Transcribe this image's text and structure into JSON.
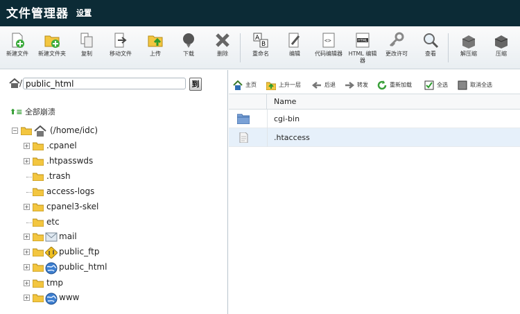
{
  "header": {
    "title": "文件管理器",
    "settings": "设置"
  },
  "toolbar": {
    "new_file": "新建文件",
    "new_folder": "新建文件夹",
    "copy": "复制",
    "move": "移动文件",
    "upload": "上传",
    "download": "下载",
    "delete": "删除",
    "rename": "重命名",
    "edit": "编辑",
    "code_edit": "代码编辑器",
    "html_edit": "HTML 编辑器",
    "permissions": "更改许可",
    "view": "查看",
    "extract": "解压缩",
    "compress": "压缩"
  },
  "path": {
    "value": "public_html",
    "go": "到"
  },
  "tree": {
    "collapse_all": "全部崩溃",
    "root": "(/home/idc)",
    "items": [
      {
        "label": ".cpanel"
      },
      {
        "label": ".htpasswds"
      },
      {
        "label": ".trash"
      },
      {
        "label": "access-logs"
      },
      {
        "label": "cpanel3-skel"
      },
      {
        "label": "etc"
      },
      {
        "label": "mail"
      },
      {
        "label": "public_ftp"
      },
      {
        "label": "public_html"
      },
      {
        "label": "tmp"
      },
      {
        "label": "www"
      }
    ]
  },
  "nav": {
    "home": "主页",
    "up": "上升一层",
    "back": "后退",
    "forward": "转发",
    "reload": "重新加载",
    "select_all": "全选",
    "unselect_all": "取消全选"
  },
  "table": {
    "header_name": "Name",
    "rows": [
      {
        "name": "cgi-bin"
      },
      {
        "name": ".htaccess"
      }
    ]
  },
  "colors": {
    "header_bg": "#0c2b36",
    "row_highlight": "#e6f0fa",
    "folder": "#f3c640"
  }
}
